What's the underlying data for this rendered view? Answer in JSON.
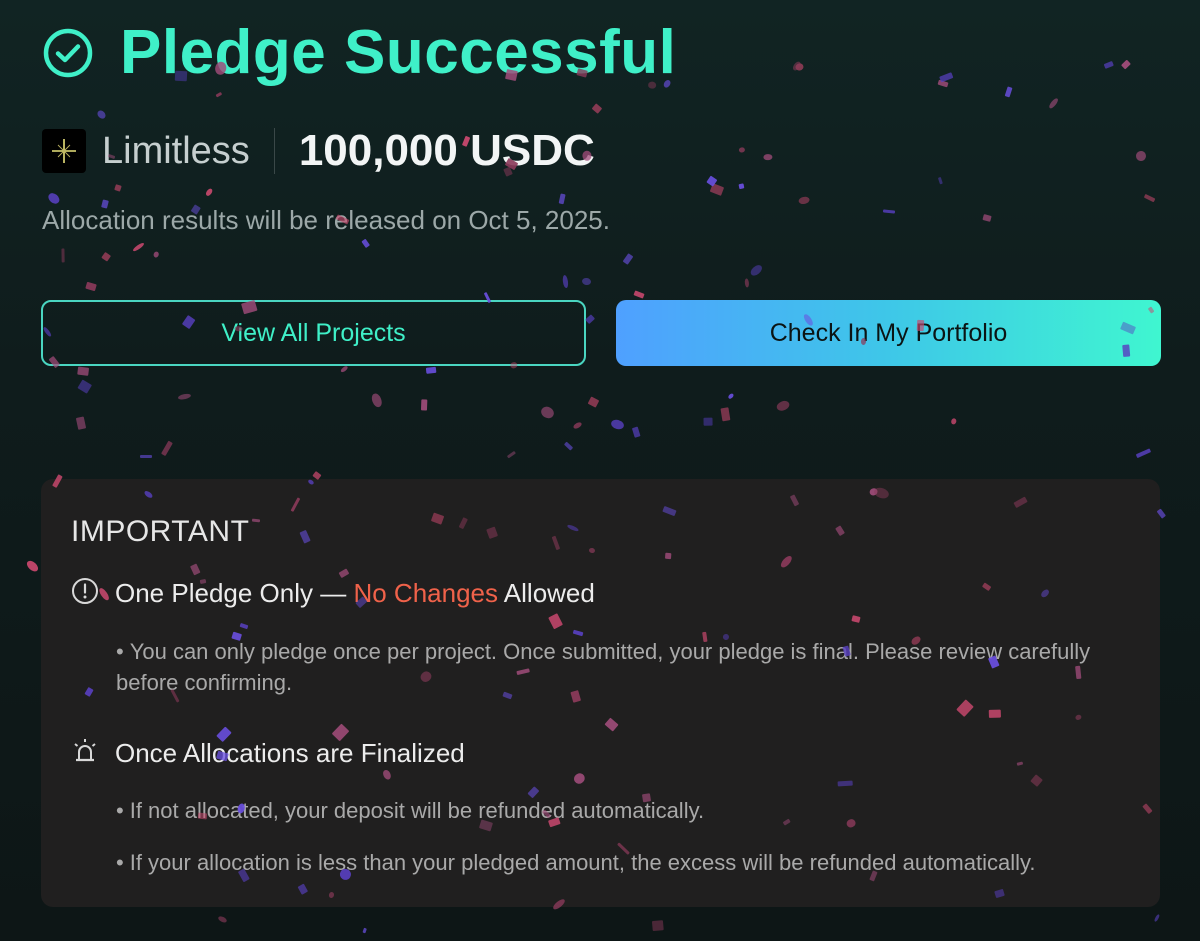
{
  "header": {
    "title": "Pledge Successful",
    "check_icon": "check-circle-icon"
  },
  "project": {
    "name": "Limitless",
    "amount": "100,000 USDC",
    "logo_icon": "limitless-logo-icon"
  },
  "release_note": "Allocation results will be released on Oct 5, 2025.",
  "buttons": {
    "view_all": "View All Projects",
    "portfolio": "Check In My Portfolio"
  },
  "important": {
    "title": "IMPORTANT",
    "section1": {
      "icon": "alert-circle-icon",
      "heading_part1": "One Pledge Only — ",
      "heading_warn": "No Changes",
      "heading_part2": " Allowed",
      "bullet": "You can only pledge once per project. Once submitted, your pledge is final. Please review carefully before confirming."
    },
    "section2": {
      "icon": "siren-icon",
      "heading": "Once Allocations are Finalized",
      "bullet1": "If not allocated, your deposit will be refunded automatically.",
      "bullet2": "If your allocation is less than your pledged amount, the excess will be refunded automatically."
    }
  },
  "colors": {
    "accent": "#3ff0c8",
    "warning": "#f0624a",
    "confetti_pink": "#c9486e",
    "confetti_purple": "#6a4fe0"
  }
}
